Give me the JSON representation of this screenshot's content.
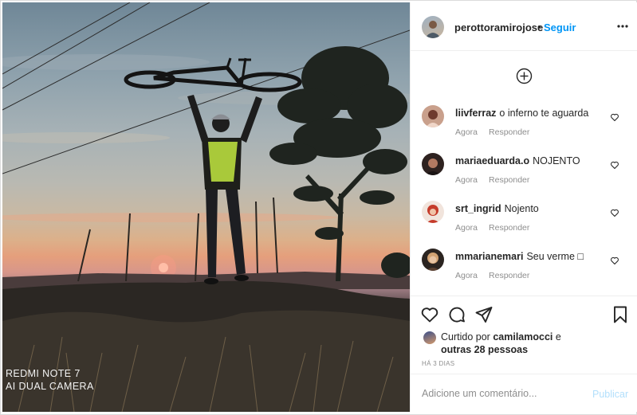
{
  "photo": {
    "watermark_line1": "REDMI NOTE 7",
    "watermark_line2": "AI DUAL CAMERA"
  },
  "header": {
    "username": "perottoramirojose",
    "dot": "•",
    "follow_label": "Seguir",
    "more_icon": "more-horizontal-icon"
  },
  "load_more_icon": "plus-circle-icon",
  "comments": [
    {
      "user": "liivferraz",
      "text": "o inferno te aguarda",
      "time": "Agora",
      "reply": "Responder"
    },
    {
      "user": "mariaeduarda.o",
      "text": "NOJENTO",
      "time": "Agora",
      "reply": "Responder"
    },
    {
      "user": "srt_ingrid",
      "text": "Nojento",
      "time": "Agora",
      "reply": "Responder"
    },
    {
      "user": "mmarianemari",
      "text": "Seu verme □",
      "time": "Agora",
      "reply": "Responder"
    }
  ],
  "actions": {
    "like_icon": "heart-icon",
    "comment_icon": "comment-icon",
    "share_icon": "send-icon",
    "save_icon": "bookmark-icon"
  },
  "likes": {
    "prefix": "Curtido por",
    "user": "camilamocci",
    "suffix": "e",
    "others": "outras 28 pessoas"
  },
  "time_ago": "HÁ 3 DIAS",
  "add_comment": {
    "placeholder": "Adicione um comentário...",
    "publish_label": "Publicar"
  },
  "colors": {
    "link_blue": "#0095f6",
    "publish_disabled": "#b2dffc",
    "muted": "#8e8e8e"
  }
}
